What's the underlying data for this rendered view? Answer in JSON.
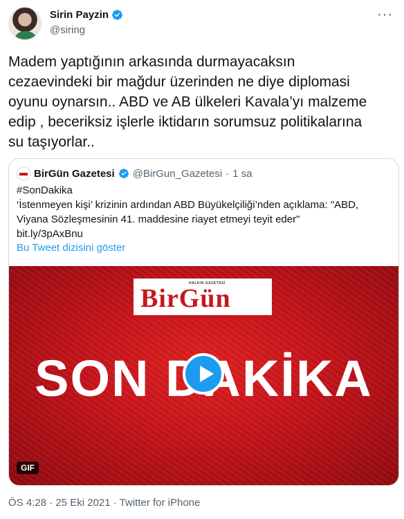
{
  "author": {
    "name": "Sirin Payzin",
    "handle": "@siring",
    "avatar": "avatar-photo",
    "verified_icon": "verified-badge-icon"
  },
  "more_icon": "more-options-icon",
  "tweet": {
    "text": "Madem yaptığının arkasında durmayacaksın\ncezaevindeki bir mağdur üzerinden ne diye diplomasi\noyunu oynarsın.. ABD ve AB ülkeleri Kavala’yı malzeme\nedip , beceriksiz işlerle iktidarın sorumsuz politikalarına\nsu taşıyorlar.."
  },
  "quote": {
    "name": "BirGün Gazetesi",
    "handle": "@BirGun_Gazetesi",
    "separator": "·",
    "time": "1 sa",
    "text": "#SonDakika\n‘İstenmeyen kişi’ krizinin ardından ABD Büyükelçiliği’nden açıklama: \"ABD,\nViyana Sözleşmesinin 41. maddesine riayet etmeyi teyit eder\"\nbit.ly/3pAxBnu",
    "show_thread": "Bu Tweet dizisini göster",
    "media": {
      "logo_small": "HALKIN GAZETESİ",
      "logo": "BirGün",
      "headline": "SON DAKİKA",
      "badge": "GIF",
      "play_icon": "play-icon"
    }
  },
  "footer": {
    "timestamp": "ÖS 4:28 · 25 Eki 2021 · Twitter for iPhone"
  },
  "colors": {
    "accent": "#1d9bf0",
    "text": "#0f1419",
    "muted": "#536471",
    "brand_red": "#c8161d"
  }
}
